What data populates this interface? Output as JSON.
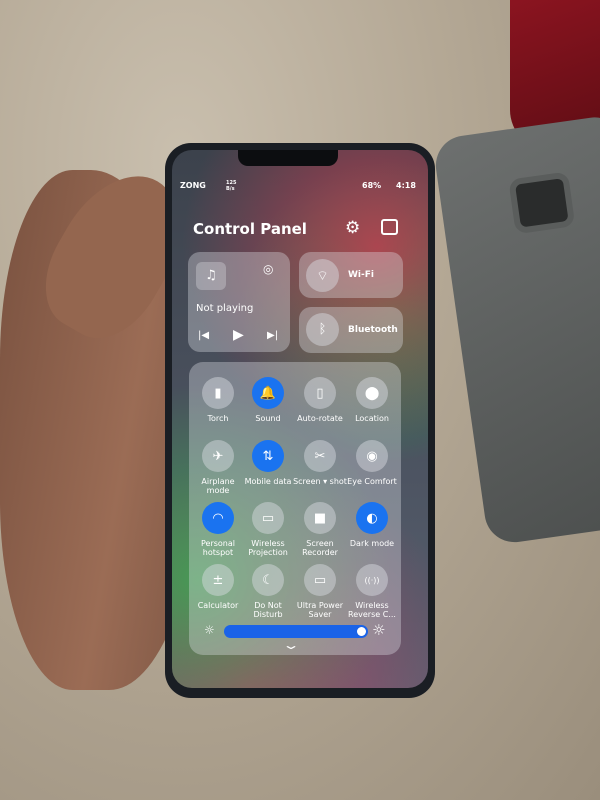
{
  "status_bar": {
    "carrier": "ZONG",
    "net_speed": "125 B/s",
    "battery": "68%",
    "time": "4:18"
  },
  "header": {
    "title": "Control Panel",
    "settings_icon": "gear-icon",
    "edit_icon": "edit-icon"
  },
  "media": {
    "status": "Not playing",
    "icons": [
      "music-note-icon",
      "cast-icon",
      "previous-icon",
      "play-icon",
      "next-icon"
    ]
  },
  "wifi": {
    "label": "Wi-Fi",
    "icon": "wifi-icon"
  },
  "bluetooth": {
    "label": "Bluetooth",
    "icon": "bluetooth-icon"
  },
  "toggles": [
    {
      "label": "Torch",
      "icon": "torch-icon",
      "on": false,
      "glyph": "▮"
    },
    {
      "label": "Sound",
      "icon": "bell-icon",
      "on": true,
      "glyph": "🔔"
    },
    {
      "label": "Auto-rotate",
      "icon": "rotate-icon",
      "on": false,
      "glyph": "▯"
    },
    {
      "label": "Location",
      "icon": "location-icon",
      "on": false,
      "glyph": "⬤"
    },
    {
      "label": "Airplane mode",
      "icon": "airplane-icon",
      "on": false,
      "glyph": "✈"
    },
    {
      "label": "Mobile data",
      "icon": "mobile-data-icon",
      "on": true,
      "glyph": "⇅"
    },
    {
      "label": "Screen ▾ shot",
      "icon": "screenshot-icon",
      "on": false,
      "glyph": "✂"
    },
    {
      "label": "Eye Comfort",
      "icon": "eye-icon",
      "on": false,
      "glyph": "◉"
    },
    {
      "label": "Personal hotspot",
      "icon": "hotspot-icon",
      "on": true,
      "glyph": "◠"
    },
    {
      "label": "Wireless Projection",
      "icon": "projection-icon",
      "on": false,
      "glyph": "▭"
    },
    {
      "label": "Screen Recorder",
      "icon": "recorder-icon",
      "on": false,
      "glyph": "■"
    },
    {
      "label": "Dark mode",
      "icon": "dark-mode-icon",
      "on": true,
      "glyph": "◐"
    },
    {
      "label": "Calculator",
      "icon": "calculator-icon",
      "on": false,
      "glyph": "±"
    },
    {
      "label": "Do Not Disturb",
      "icon": "moon-icon",
      "on": false,
      "glyph": "☾"
    },
    {
      "label": "Ultra Power Saver",
      "icon": "battery-icon",
      "on": false,
      "glyph": "▭"
    },
    {
      "label": "Wireless Reverse C...",
      "icon": "reverse-charge-icon",
      "on": false,
      "glyph": "((·))"
    }
  ],
  "brightness": {
    "level": 0.95,
    "icon": "sun-icon"
  },
  "colors": {
    "accent": "#1a73f0"
  }
}
